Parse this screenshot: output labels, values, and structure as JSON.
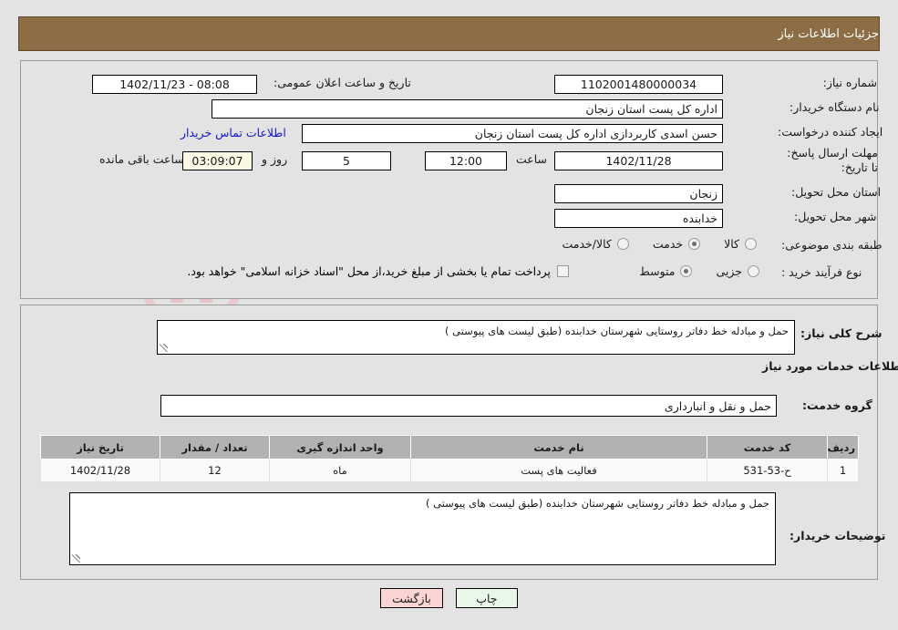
{
  "header": {
    "title": "جزئیات اطلاعات نیاز"
  },
  "watermark": {
    "text": "AriaTender.net"
  },
  "top_form": {
    "need_number": {
      "label": "شماره نیاز:",
      "value": "1102001480000034"
    },
    "announce_datetime": {
      "label": "تاریخ و ساعت اعلان عمومی:",
      "value": "08:08 - 1402/11/23"
    },
    "buyer_org": {
      "label": "نام دستگاه خریدار:",
      "value": "اداره کل پست استان زنجان"
    },
    "request_creator": {
      "label": "ایجاد کننده درخواست:",
      "value": "حسن  اسدی کاربردازی اداره کل پست استان زنجان"
    },
    "buyer_contact_link": "اطلاعات تماس خریدار",
    "deadline": {
      "label": "مهلت ارسال پاسخ: تا تاریخ:",
      "date": "1402/11/28",
      "hour_label": "ساعت",
      "hour": "12:00",
      "days": "5",
      "days_label": "روز و",
      "countdown": "03:09:07",
      "countdown_label": "ساعت باقی مانده"
    },
    "delivery_province": {
      "label": "استان محل تحویل:",
      "value": "زنجان"
    },
    "delivery_city": {
      "label": "شهر محل تحویل:",
      "value": "خدابنده"
    },
    "subject_class": {
      "label": "طبقه بندی موضوعی:",
      "options": [
        {
          "text": "کالا",
          "selected": false
        },
        {
          "text": "خدمت",
          "selected": true
        },
        {
          "text": "کالا/خدمت",
          "selected": false
        }
      ]
    },
    "purchase_type": {
      "label": "نوع فرآیند خرید :",
      "options": [
        {
          "text": "جزیی",
          "selected": false
        },
        {
          "text": "متوسط",
          "selected": true
        }
      ],
      "checkbox_text": "پرداخت تمام یا بخشی از مبلغ خرید،از محل \"اسناد خزانه اسلامی\" خواهد بود."
    }
  },
  "bottom_form": {
    "general_desc": {
      "label": "شرح کلی نیاز:",
      "value": "حمل و مبادله خط دفاتر روستایی شهرستان خدابنده   (طبق لیست های پیوستی )"
    },
    "services_section_title": "اطلاعات خدمات مورد نیاز",
    "service_group": {
      "label": "گروه خدمت:",
      "value": "حمل و نقل و انبارداری"
    },
    "table": {
      "columns": [
        "ردیف",
        "کد خدمت",
        "نام خدمت",
        "واحد اندازه گیری",
        "تعداد / مقدار",
        "تاریخ نیاز"
      ],
      "rows": [
        [
          "1",
          "ح-53-531",
          "فعالیت های پست",
          "ماه",
          "12",
          "1402/11/28"
        ]
      ]
    },
    "buyer_notes": {
      "label": "توضیحات خریدار:",
      "value": "حمل و مبادله خط دفاتر روستایی شهرستان خدابنده   (طبق لیست های پیوستی )"
    }
  },
  "buttons": {
    "print": "چاپ",
    "back": "بازگشت"
  }
}
